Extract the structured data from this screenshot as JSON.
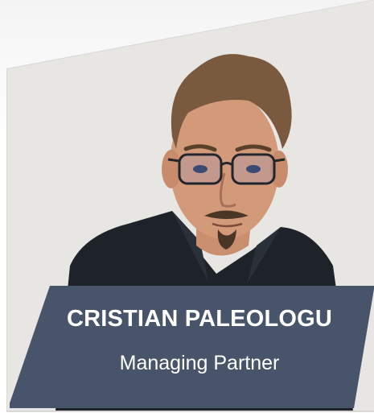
{
  "profile": {
    "name": "CRISTIAN PALEOLOGU",
    "role": "Managing Partner"
  },
  "colors": {
    "banner": "#475469",
    "card_background": "#e7e6e3",
    "shirt": "#1e2329",
    "text": "#ffffff"
  },
  "icons": {
    "portrait": "portrait-photo"
  }
}
